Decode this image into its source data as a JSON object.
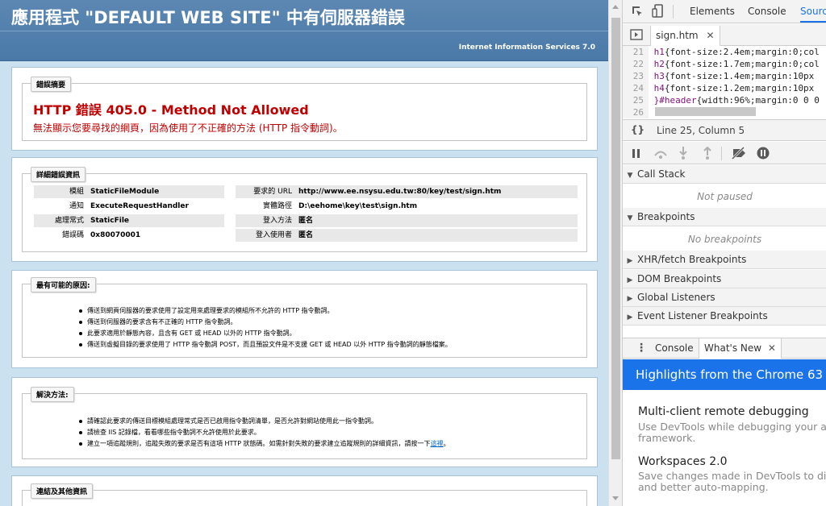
{
  "iis": {
    "title": "應用程式 \"DEFAULT WEB SITE\" 中有伺服器錯誤",
    "server": "Internet Information Services 7.0",
    "error_summary": {
      "legend": "錯誤摘要",
      "title": "HTTP 錯誤 405.0 - Method Not Allowed",
      "description": "無法顯示您要尋找的網頁，因為使用了不正確的方法 (HTTP 指令動詞)。"
    },
    "details": {
      "legend": "詳細錯誤資訊",
      "left": [
        {
          "key": "模組",
          "value": "StaticFileModule"
        },
        {
          "key": "通知",
          "value": "ExecuteRequestHandler"
        },
        {
          "key": "處理常式",
          "value": "StaticFile"
        },
        {
          "key": "錯誤碼",
          "value": "0x80070001"
        }
      ],
      "right": [
        {
          "key": "要求的 URL",
          "value": "http://www.ee.nsysu.edu.tw:80/key/test/sign.htm"
        },
        {
          "key": "實體路徑",
          "value": "D:\\eehome\\key\\test\\sign.htm"
        },
        {
          "key": "登入方法",
          "value": "匿名"
        },
        {
          "key": "登入使用者",
          "value": "匿名"
        }
      ]
    },
    "causes": {
      "legend": "最有可能的原因:",
      "items": [
        "傳送到網頁伺服器的要求使用了設定用來處理要求的模組所不允許的 HTTP 指令動詞。",
        "傳送到伺服器的要求含有不正確的 HTTP 指令動詞。",
        "此要求適用於靜態內容，且含有 GET 或 HEAD 以外的 HTTP 指令動詞。",
        "傳送到虛擬目錄的要求使用了 HTTP 指令動詞 POST，而且預設文件是不支援 GET 或 HEAD 以外 HTTP 指令動詞的靜態檔案。"
      ]
    },
    "solutions": {
      "legend": "解決方法:",
      "items": [
        "請確認此要求的傳送目標模組處理常式是否已啟用指令動詞清單，是否允許對網站使用此一指令動詞。",
        "請檢查 IIS 記錄檔，看看哪些指令動詞不允許使用於此要求。"
      ],
      "item3_text": "建立一項追蹤規則，追蹤失敗的要求是否有這項 HTTP 狀態碼。如需針對失敗的要求建立追蹤規則的詳細資訊，請按一下",
      "item3_link": "這裡",
      "item3_end": "。"
    },
    "links": {
      "legend": "連結及其他資訊"
    }
  },
  "devtools": {
    "tabs": [
      "Elements",
      "Console",
      "Sources"
    ],
    "active_tab": "Sources",
    "file_tab": "sign.htm",
    "code_lines": [
      {
        "num": "21",
        "sel": "h1",
        "body": "{font-size:2.4em;margin:0;col"
      },
      {
        "num": "22",
        "sel": "h2",
        "body": "{font-size:1.7em;margin:0;col"
      },
      {
        "num": "23",
        "sel": "h3",
        "body": "{font-size:1.4em;margin:10px"
      },
      {
        "num": "24",
        "sel": "h4",
        "body": "{font-size:1.2em;margin:10px"
      },
      {
        "num": "25",
        "sel": "}#header",
        "body": "{width:96%;margin:0 0 0"
      },
      {
        "num": "26",
        "sel": "",
        "body": ""
      }
    ],
    "cursor_position": "Line 25, Column 5",
    "braces_label": "{}",
    "call_stack": {
      "title": "Call Stack",
      "body": "Not paused"
    },
    "breakpoints": {
      "title": "Breakpoints",
      "body": "No breakpoints"
    },
    "collapsed_sections": [
      "XHR/fetch Breakpoints",
      "DOM Breakpoints",
      "Global Listeners",
      "Event Listener Breakpoints"
    ],
    "drawer_tabs": {
      "console": "Console",
      "whats_new": "What's New"
    },
    "banner": "Highlights from the Chrome 63",
    "news": [
      {
        "title": "Multi-client remote debugging",
        "desc1": "Use DevTools while debugging your ap",
        "desc2": "framework."
      },
      {
        "title": "Workspaces 2.0",
        "desc1": "Save changes made in DevTools to disk",
        "desc2": "and better auto-mapping."
      }
    ],
    "accent_color": "#1a73e8"
  }
}
